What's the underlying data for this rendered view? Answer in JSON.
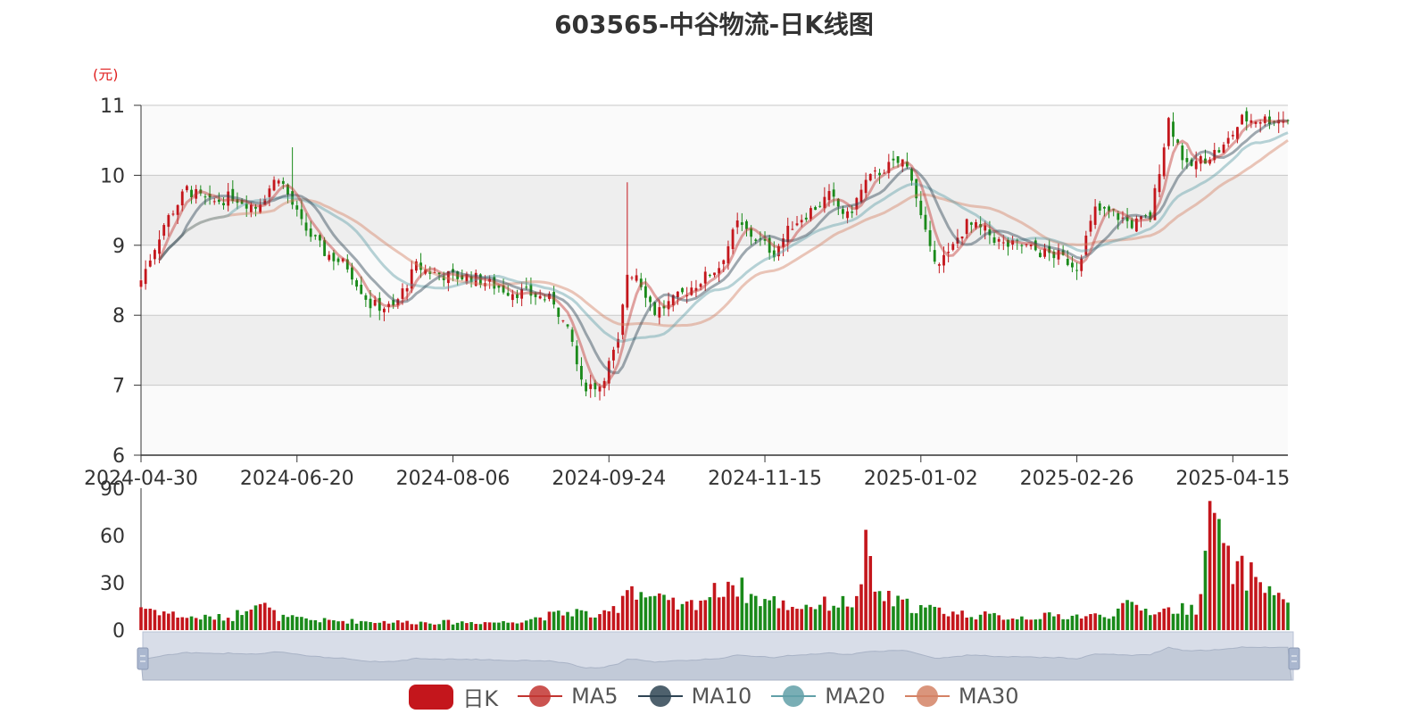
{
  "title": "603565-中谷物流-日K线图",
  "unit_label": "(元)",
  "colors": {
    "up": "#c4161c",
    "down": "#1a8a1a",
    "ma5": "#c23531",
    "ma10": "#2f4554",
    "ma20": "#61a0a8",
    "ma30": "#d48265"
  },
  "legend": [
    {
      "key": "kline",
      "label": "日K",
      "icon": "rounded-box",
      "color": "#c4161c"
    },
    {
      "key": "ma5",
      "label": "MA5",
      "icon": "line-dot",
      "color": "#c23531"
    },
    {
      "key": "ma10",
      "label": "MA10",
      "icon": "line-dot",
      "color": "#2f4554"
    },
    {
      "key": "ma20",
      "label": "MA20",
      "icon": "line-dot",
      "color": "#61a0a8"
    },
    {
      "key": "ma30",
      "label": "MA30",
      "icon": "line-dot",
      "color": "#d48265"
    }
  ],
  "chart_data": {
    "type": "candlestick",
    "title": "603565-中谷物流-日K线图",
    "ylabel": "(元)",
    "price_ylim": [
      6,
      11
    ],
    "price_yticks": [
      6,
      7,
      8,
      9,
      10,
      11
    ],
    "volume_ylim": [
      0,
      90
    ],
    "volume_yticks": [
      0,
      30,
      60,
      90
    ],
    "x_tick_labels": [
      "2024-04-30",
      "2024-06-20",
      "2024-08-06",
      "2024-09-24",
      "2024-11-15",
      "2025-01-02",
      "2025-02-26",
      "2025-04-15"
    ],
    "x_tick_index": [
      0,
      34,
      68,
      102,
      136,
      170,
      204,
      238
    ],
    "close_path": {
      "index": [
        0,
        5,
        10,
        15,
        20,
        25,
        30,
        35,
        40,
        45,
        50,
        55,
        60,
        64,
        68,
        72,
        80,
        85,
        90,
        94,
        96,
        100,
        104,
        106,
        108,
        112,
        116,
        120,
        126,
        130,
        134,
        138,
        142,
        146,
        150,
        154,
        158,
        162,
        166,
        168,
        170,
        172,
        174,
        176,
        178,
        180,
        184,
        188,
        192,
        196,
        200,
        204,
        208,
        212,
        216,
        220,
        224,
        228,
        232,
        236,
        240
      ],
      "values": [
        8.5,
        9.3,
        9.8,
        9.6,
        9.7,
        9.55,
        10.0,
        9.3,
        8.9,
        8.7,
        8.15,
        8.1,
        8.7,
        8.6,
        8.55,
        8.55,
        8.35,
        8.3,
        8.2,
        7.6,
        7.0,
        7.0,
        7.6,
        8.6,
        8.6,
        8.05,
        8.2,
        8.4,
        8.7,
        9.3,
        9.1,
        8.9,
        9.3,
        9.5,
        9.7,
        9.4,
        9.9,
        10.1,
        10.2,
        10.0,
        9.4,
        8.9,
        8.8,
        8.85,
        9.1,
        9.3,
        9.2,
        9.0,
        9.0,
        8.9,
        8.85,
        8.7,
        9.5,
        9.45,
        9.3,
        9.4,
        10.8,
        10.1,
        10.25,
        10.4,
        10.8
      ]
    },
    "volume_path": {
      "index": [
        0,
        10,
        20,
        25,
        27,
        30,
        40,
        60,
        80,
        95,
        100,
        104,
        106,
        110,
        118,
        126,
        128,
        134,
        138,
        142,
        156,
        158,
        160,
        164,
        170,
        180,
        190,
        200,
        210,
        216,
        220,
        230,
        234,
        236,
        238,
        242,
        244,
        246,
        248,
        250
      ],
      "values": [
        15,
        8,
        8,
        20,
        15,
        8,
        6,
        5,
        5,
        12,
        8,
        15,
        30,
        22,
        14,
        25,
        32,
        20,
        18,
        15,
        18,
        50,
        25,
        18,
        14,
        10,
        8,
        9,
        9,
        16,
        12,
        14,
        82,
        46,
        38,
        35,
        32,
        26,
        20,
        22
      ]
    }
  },
  "volume_axis_labels": [
    "0",
    "30",
    "60",
    "90"
  ]
}
